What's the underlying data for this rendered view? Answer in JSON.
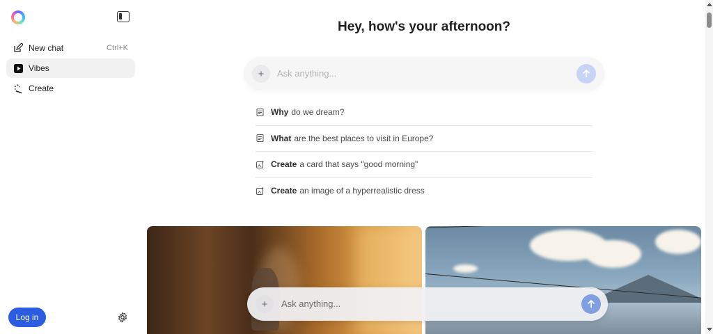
{
  "sidebar": {
    "items": [
      {
        "label": "New chat",
        "shortcut": "Ctrl+K",
        "icon": "edit-icon"
      },
      {
        "label": "Vibes",
        "icon": "play-icon"
      },
      {
        "label": "Create",
        "icon": "magic-wand-icon"
      }
    ],
    "login_label": "Log in"
  },
  "main": {
    "greeting": "Hey, how's your afternoon?",
    "search": {
      "placeholder": "Ask anything..."
    },
    "suggestions": [
      {
        "bold": "Why",
        "rest": "do we dream?",
        "icon": "document-icon"
      },
      {
        "bold": "What",
        "rest": "are the best places to visit in Europe?",
        "icon": "document-icon"
      },
      {
        "bold": "Create",
        "rest": "a card that says \"good morning\"",
        "icon": "image-sparkle-icon"
      },
      {
        "bold": "Create",
        "rest": "an image of a hyperrealistic dress",
        "icon": "image-sparkle-icon"
      }
    ],
    "bottom_search": {
      "placeholder": "Ask anything..."
    }
  },
  "colors": {
    "accent": "#2b5de0",
    "send_active": "#7f9fe0",
    "send_inactive": "#c7d4f3"
  }
}
